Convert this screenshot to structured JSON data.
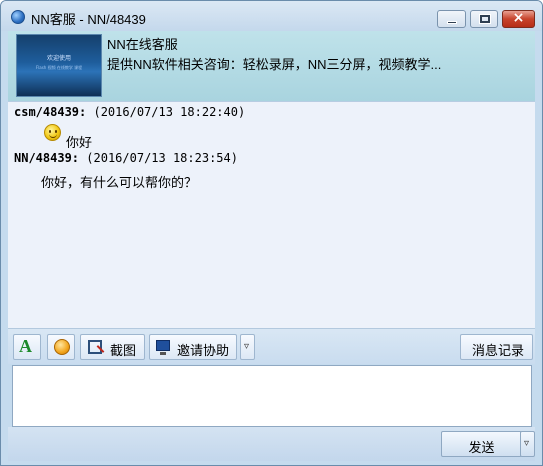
{
  "window": {
    "title": "NN客服 - NN/48439"
  },
  "header": {
    "name": "NN在线客服",
    "description": "提供NN软件相关咨询：轻松录屏，NN三分屏，视频教学...",
    "banner": {
      "line1": "欢迎使用",
      "line2": "Flash 视频 在线教学 课程"
    }
  },
  "chat": {
    "messages": [
      {
        "user": "csm/48439:",
        "time": "(2016/07/13 18:22:40)",
        "text": "你好",
        "has_emoji": true
      },
      {
        "user": "NN/48439:",
        "time": "(2016/07/13 18:23:54)",
        "text": "你好，有什么可以帮你的？",
        "has_emoji": false
      }
    ]
  },
  "toolbar": {
    "font_icon": "A",
    "screenshot_label": "截图",
    "assist_label": "邀请协助",
    "dropdown_glyph": "▿",
    "history_label": "消息记录"
  },
  "input": {
    "value": "",
    "placeholder": ""
  },
  "footer": {
    "send_label": "发送",
    "dropdown_glyph": "▿"
  },
  "colors": {
    "close_button": "#c7432c",
    "chat_background": "#edf2fa",
    "header_background": "#b4dae4"
  }
}
